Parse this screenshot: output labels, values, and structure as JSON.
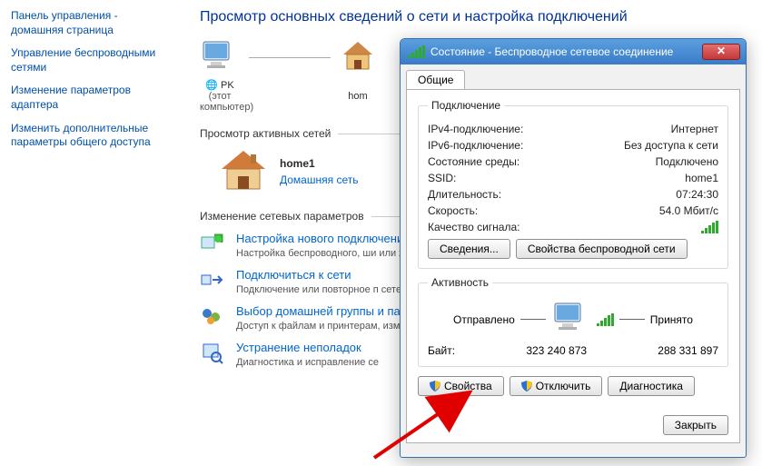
{
  "sidebar": {
    "links": [
      "Панель управления - домашняя страница",
      "Управление беспроводными сетями",
      "Изменение параметров адаптера",
      "Изменить дополнительные параметры общего доступа"
    ]
  },
  "page": {
    "title": "Просмотр основных сведений о сети и настройка подключений",
    "nodes": {
      "pc": "PK",
      "pc_sub": "(этот компьютер)",
      "network": "hom"
    },
    "section_active": "Просмотр активных сетей",
    "home_name": "home1",
    "home_type": "Домашняя сеть",
    "section_change": "Изменение сетевых параметров",
    "tasks": [
      {
        "title": "Настройка нового подключени",
        "desc": "Настройка беспроводного, ши\nили же настройка маршрутиз"
      },
      {
        "title": "Подключиться к сети",
        "desc": "Подключение или повторное п\nсетевому соединению или под"
      },
      {
        "title": "Выбор домашней группы и па",
        "desc": "Доступ к файлам и принтерам,\nизменение параметров общего"
      },
      {
        "title": "Устранение неполадок",
        "desc": "Диагностика и исправление се"
      }
    ]
  },
  "dialog": {
    "title": "Состояние - Беспроводное сетевое соединение",
    "tab": "Общие",
    "grp_connection": "Подключение",
    "conn": {
      "ipv4_k": "IPv4-подключение:",
      "ipv4_v": "Интернет",
      "ipv6_k": "IPv6-подключение:",
      "ipv6_v": "Без доступа к сети",
      "media_k": "Состояние среды:",
      "media_v": "Подключено",
      "ssid_k": "SSID:",
      "ssid_v": "home1",
      "dur_k": "Длительность:",
      "dur_v": "07:24:30",
      "speed_k": "Скорость:",
      "speed_v": "54.0 Мбит/с",
      "signal_k": "Качество сигнала:"
    },
    "btn_details": "Сведения...",
    "btn_wireless_props": "Свойства беспроводной сети",
    "grp_activity": "Активность",
    "activity": {
      "sent_label": "Отправлено",
      "received_label": "Принято",
      "bytes_label": "Байт:",
      "sent": "323 240 873",
      "received": "288 331 897"
    },
    "btn_props": "Свойства",
    "btn_disable": "Отключить",
    "btn_diag": "Диагностика",
    "btn_close": "Закрыть"
  }
}
